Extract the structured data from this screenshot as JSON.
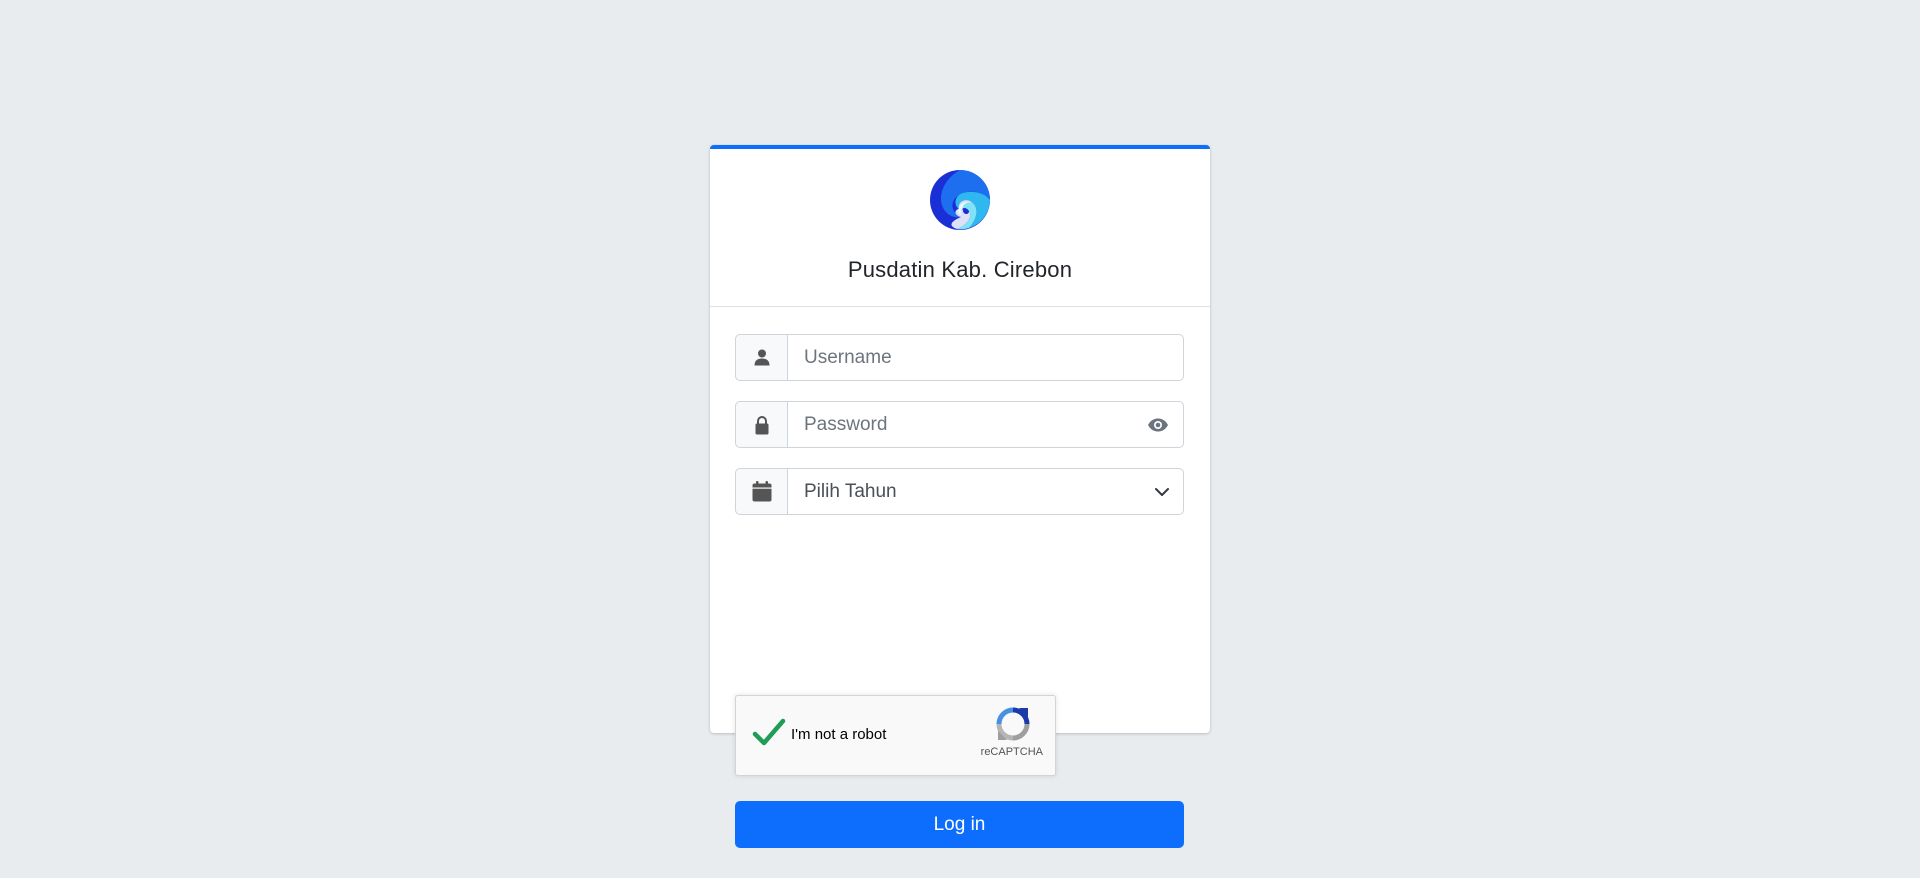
{
  "header": {
    "title": "Pusdatin Kab. Cirebon",
    "logo_icon": "kominfo-logo-icon"
  },
  "form": {
    "username": {
      "icon": "user-icon",
      "placeholder": "Username",
      "value": ""
    },
    "password": {
      "icon": "lock-icon",
      "placeholder": "Password",
      "value": "",
      "toggle_icon": "eye-icon"
    },
    "year": {
      "icon": "calendar-icon",
      "selected": "Pilih Tahun",
      "dropdown_icon": "chevron-down-icon"
    },
    "recaptcha": {
      "label": "I'm not a robot",
      "brand": "reCAPTCHA",
      "checked": true
    },
    "login_label": "Log in"
  },
  "colors": {
    "accent": "#0d6efd",
    "background": "#e8ecef",
    "check": "#1e9e55"
  }
}
